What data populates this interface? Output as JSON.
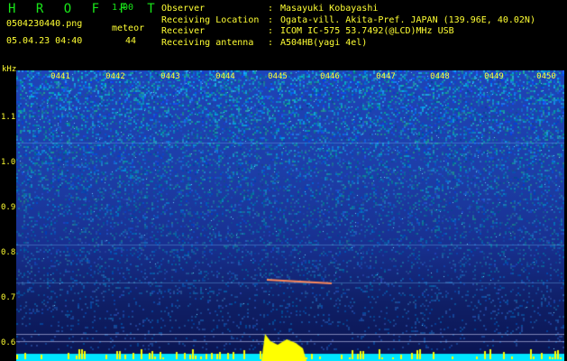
{
  "header": {
    "app_title": "H R O F F T",
    "app_version": "1.00",
    "file_name": "0504230440.png",
    "date_time": "05.04.23 04:40",
    "meteor_label": "meteor",
    "meteor_count": "44"
  },
  "info": {
    "observer_label": "Observer",
    "observer_value": "Masayuki Kobayashi",
    "location_label": "Receiving Location",
    "location_value": "Ogata-vill. Akita-Pref. JAPAN (139.96E, 40.02N)",
    "receiver_label": "Receiver",
    "receiver_value": "ICOM IC-575 53.7492(@LCD)MHz USB",
    "antenna_label": "Receiving antenna",
    "antenna_value": "A504HB(yagi 4el)",
    "separator": ":"
  },
  "spectrogram": {
    "freq_unit": "kHz",
    "time_labels": [
      "0441",
      "0442",
      "0443",
      "0444",
      "0445",
      "0446",
      "0447",
      "0448",
      "0449",
      "0450"
    ],
    "freq_labels": [
      "1.1",
      "1.0",
      "0.9",
      "0.8",
      "0.7",
      "0.6"
    ],
    "colors": {
      "background": "#000000",
      "text": "#ffff33",
      "title": "#19e619",
      "marker": "#ffff00",
      "baseline": "#00e5ff"
    }
  }
}
